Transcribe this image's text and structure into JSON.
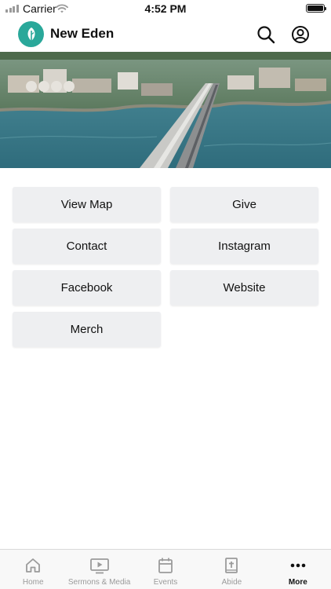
{
  "status_bar": {
    "carrier": "Carrier",
    "time": "4:52 PM",
    "battery_level": 1.0
  },
  "header": {
    "title": "New Eden",
    "logo_color": "#2aa89a",
    "left_icon": "leaf-logo-icon",
    "right_icons": [
      "search-icon",
      "profile-icon"
    ]
  },
  "hero": {
    "description_icon": "aerial-bridge-photo"
  },
  "links": [
    {
      "label": "View Map"
    },
    {
      "label": "Give"
    },
    {
      "label": "Contact"
    },
    {
      "label": "Instagram"
    },
    {
      "label": "Facebook"
    },
    {
      "label": "Website"
    },
    {
      "label": "Merch"
    }
  ],
  "tabs": [
    {
      "label": "Home",
      "icon": "home-icon",
      "active": false
    },
    {
      "label": "Sermons & Media",
      "icon": "tv-play-icon",
      "active": false
    },
    {
      "label": "Events",
      "icon": "calendar-icon",
      "active": false
    },
    {
      "label": "Abide",
      "icon": "bible-icon",
      "active": false
    },
    {
      "label": "More",
      "icon": "more-dots-icon",
      "active": true
    }
  ],
  "colors": {
    "button_bg": "#eeeff1",
    "tab_inactive": "#9b9b9b",
    "tab_active": "#111111"
  }
}
